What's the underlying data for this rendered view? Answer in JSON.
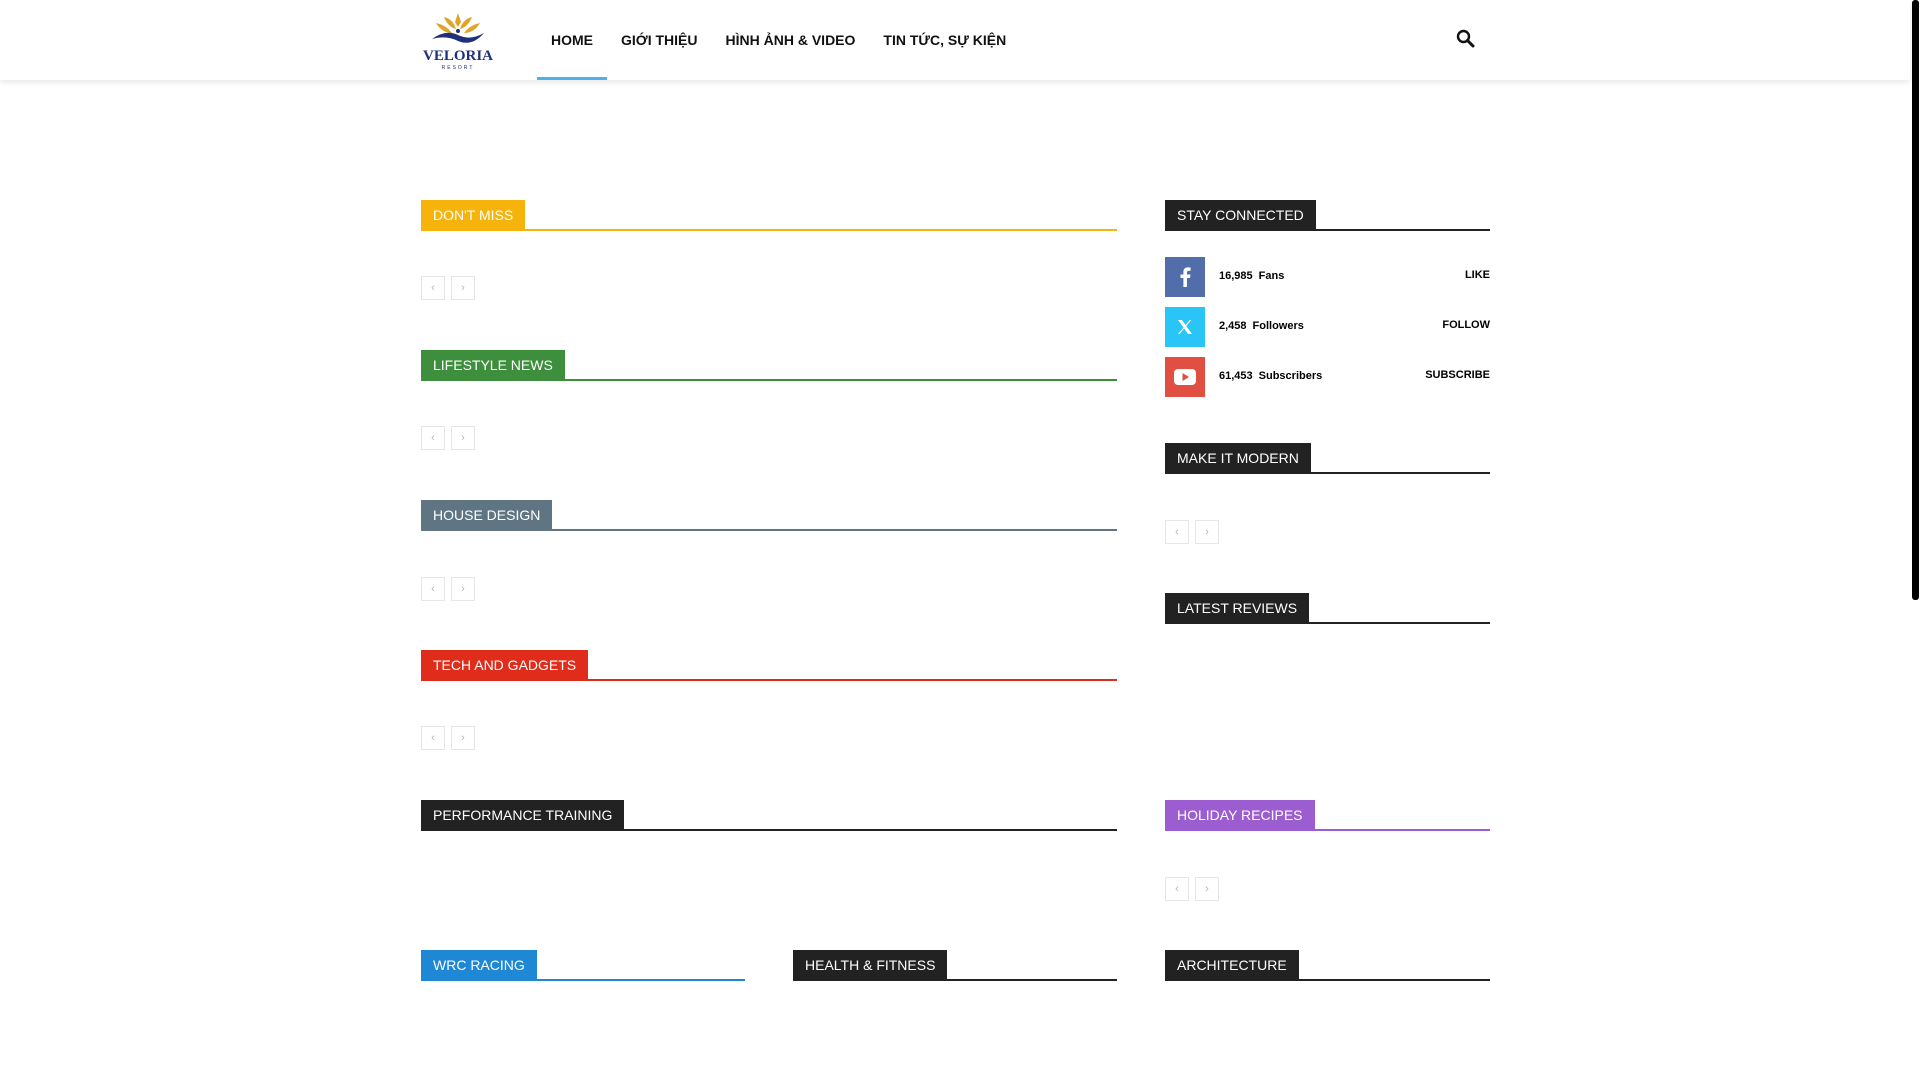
{
  "header": {
    "logo_text": "VELORIA",
    "logo_sub": "RESORT",
    "nav": [
      "HOME",
      "GIỚI THIỆU",
      "HÌNH ẢNH & VIDEO",
      "TIN TỨC, SỰ KIỆN"
    ],
    "active_nav": "HOME"
  },
  "icons": {
    "search": "search-icon",
    "facebook": "facebook-icon",
    "twitter": "x-twitter-icon",
    "youtube": "youtube-icon"
  },
  "blocks": {
    "dont_miss": {
      "title": "DON'T MISS",
      "color": "#f6b30c"
    },
    "lifestyle_news": {
      "title": "LIFESTYLE NEWS",
      "color": "#3d8f3d"
    },
    "house_design": {
      "title": "HOUSE DESIGN",
      "color": "#5f7584"
    },
    "tech_gadgets": {
      "title": "TECH AND GADGETS",
      "color": "#e02c1b"
    },
    "performance_training": {
      "title": "PERFORMANCE TRAINING",
      "color": "#222222"
    },
    "wrc_racing": {
      "title": "WRC RACING",
      "color": "#1e88d4"
    },
    "health_fitness": {
      "title": "HEALTH & FITNESS",
      "color": "#222222"
    },
    "architecture": {
      "title": "ARCHITECTURE",
      "color": "#222222"
    },
    "stay_connected": {
      "title": "STAY CONNECTED",
      "color": "#222222"
    },
    "make_it_modern": {
      "title": "MAKE IT MODERN",
      "color": "#222222"
    },
    "latest_reviews": {
      "title": "LATEST REVIEWS",
      "color": "#222222"
    },
    "holiday_recipes": {
      "title": "HOLIDAY RECIPES",
      "color": "#9c5dd1"
    }
  },
  "pager": {
    "prev": "‹",
    "next": "›"
  },
  "social": [
    {
      "count": "16,985",
      "unit": "Fans",
      "action": "LIKE",
      "color": "#516eab"
    },
    {
      "count": "2,458",
      "unit": "Followers",
      "action": "FOLLOW",
      "color": "#29c5f6"
    },
    {
      "count": "61,453",
      "unit": "Subscribers",
      "action": "SUBSCRIBE",
      "color": "#e14e42"
    }
  ]
}
